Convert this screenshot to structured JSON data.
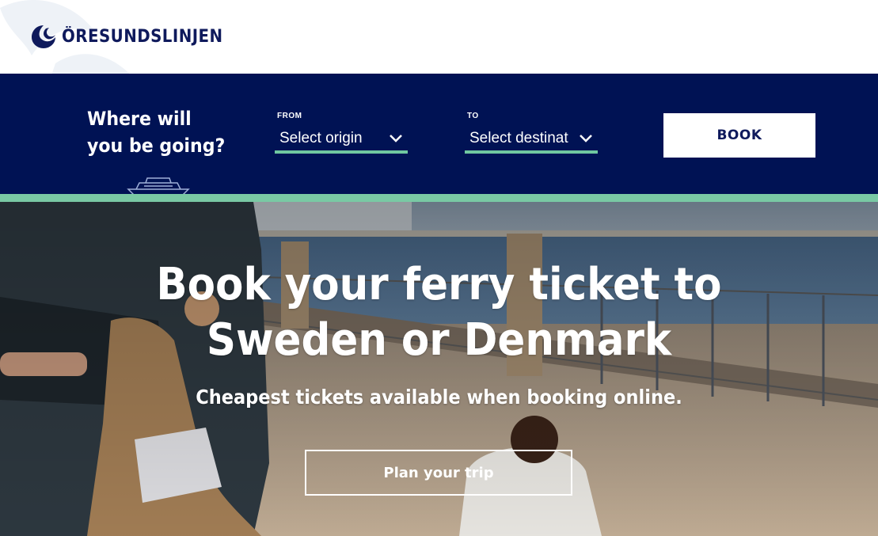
{
  "header": {
    "logo_text": "ÖRESUNDSLINJEN"
  },
  "booking": {
    "title": "Where will\nyou be going?",
    "from": {
      "label": "FROM",
      "value": "Select origin"
    },
    "to": {
      "label": "TO",
      "value": "Select destinat"
    },
    "book_label": "BOOK"
  },
  "hero": {
    "title": "Book your ferry ticket to Sweden or Denmark",
    "subtitle": "Cheapest tickets available when booking online.",
    "cta_label": "Plan your trip"
  },
  "icons": {
    "logo": "wave-logo-icon",
    "ship": "ferry-ship-icon",
    "chevron": "chevron-down-icon"
  },
  "colors": {
    "navy": "#001254",
    "brand_text": "#0f1a5c",
    "accent_green": "#79c9a4",
    "white": "#ffffff"
  }
}
